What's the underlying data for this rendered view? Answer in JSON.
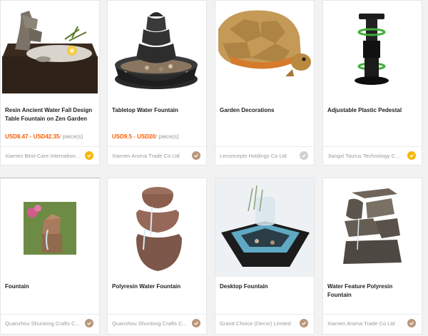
{
  "products": [
    {
      "title": "Resin Ancient Water Fall Design Table Fountain on Zen Garden",
      "price_range": "USD8.47 - USD42.35",
      "price_unit": "/ piece(s)",
      "supplier": "Xiamen Best-Care Internation...",
      "badge": "gold-verified-icon",
      "badge_color": "#f5b700"
    },
    {
      "title": "Tabletop Water Fountain",
      "price_range": "USD9.5 - USD20",
      "price_unit": "/ piece(s)",
      "supplier": "Xiamen Aroma Trade Co Ltd",
      "badge": "verified-icon",
      "badge_color": "#b9977a"
    },
    {
      "title": "Garden Decorations",
      "price_range": "",
      "price_unit": "",
      "supplier": "Leconcepts Holdings Co Ltd",
      "badge": "verified-icon",
      "badge_color": "#d0d0d0"
    },
    {
      "title": "Adjustable Plastic Pedestal",
      "price_range": "",
      "price_unit": "",
      "supplier": "Jiangxi Taurus Technology C...",
      "badge": "gold-verified-icon",
      "badge_color": "#f5b700"
    },
    {
      "title": "Fountain",
      "price_range": "",
      "price_unit": "",
      "supplier": "Quanzhou Shuntong Crafts C...",
      "badge": "verified-icon",
      "badge_color": "#b9977a"
    },
    {
      "title": "Polyresin Water Fountain",
      "price_range": "",
      "price_unit": "",
      "supplier": "Quanzhou Shuntong Crafts C...",
      "badge": "verified-icon",
      "badge_color": "#b9977a"
    },
    {
      "title": "Desktop Fountain",
      "price_range": "",
      "price_unit": "",
      "supplier": "Grand Choice (Decor) Limited",
      "badge": "verified-icon",
      "badge_color": "#b9977a"
    },
    {
      "title": "Water Feature Polyresin Fountain",
      "price_range": "",
      "price_unit": "",
      "supplier": "Xiamen Aroma Trade Co Ltd",
      "badge": "verified-icon",
      "badge_color": "#b9977a"
    }
  ]
}
